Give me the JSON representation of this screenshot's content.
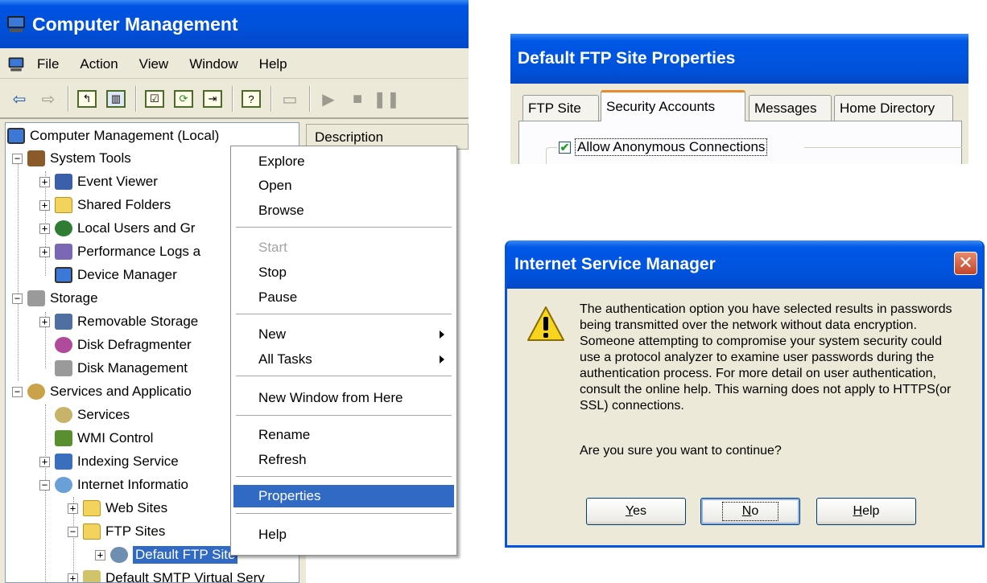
{
  "computer_management": {
    "title": "Computer Management",
    "menu": [
      "File",
      "Action",
      "View",
      "Window",
      "Help"
    ],
    "toolbar_icons": [
      "back-arrow-icon",
      "forward-arrow-icon",
      "up-folder-icon",
      "show-hide-tree-icon",
      "properties-icon",
      "refresh-icon",
      "export-list-icon",
      "help-icon",
      "connect-computer-icon",
      "start-icon",
      "stop-icon",
      "pause-icon"
    ],
    "description_header": "Description",
    "tree": {
      "root": "Computer Management (Local)",
      "system_tools": "System Tools",
      "event_viewer": "Event Viewer",
      "shared_folders": "Shared Folders",
      "local_users": "Local Users and Gr",
      "performance_logs": "Performance Logs a",
      "device_manager": "Device Manager",
      "storage": "Storage",
      "removable_storage": "Removable Storage",
      "disk_defragmenter": "Disk Defragmenter",
      "disk_management": "Disk Management",
      "services_and_apps": "Services and Applicatio",
      "services": "Services",
      "wmi_control": "WMI Control",
      "indexing_service": "Indexing Service",
      "iis": "Internet Informatio",
      "web_sites": "Web Sites",
      "ftp_sites": "FTP Sites",
      "default_ftp_site": "Default FTP Site",
      "default_smtp": "Default SMTP Virtual Serv"
    },
    "context_menu": {
      "explore": "Explore",
      "open": "Open",
      "browse": "Browse",
      "start": "Start",
      "stop": "Stop",
      "pause": "Pause",
      "new": "New",
      "all_tasks": "All Tasks",
      "new_window": "New Window from Here",
      "rename": "Rename",
      "refresh": "Refresh",
      "properties": "Properties",
      "help": "Help"
    }
  },
  "ftp_properties": {
    "title": "Default FTP Site Properties",
    "tabs": [
      "FTP Site",
      "Security Accounts",
      "Messages",
      "Home Directory"
    ],
    "active_tab": "Security Accounts",
    "allow_anonymous": {
      "label": "Allow Anonymous Connections",
      "checked": true
    }
  },
  "ism_dialog": {
    "title": "Internet Service Manager",
    "message": "The authentication option you have selected results in passwords being transmitted over the network without data encryption. Someone attempting to compromise your system security could use a protocol analyzer to examine user passwords during the authentication process. For more detail on user authentication, consult the online help.  This warning does not apply to HTTPS(or SSL) connections.",
    "question": "Are you sure you want to continue?",
    "buttons": {
      "yes": {
        "mnemonic": "Y",
        "rest": "es"
      },
      "no": {
        "mnemonic": "N",
        "rest": "o"
      },
      "help": {
        "mnemonic": "H",
        "rest": "elp"
      }
    }
  }
}
